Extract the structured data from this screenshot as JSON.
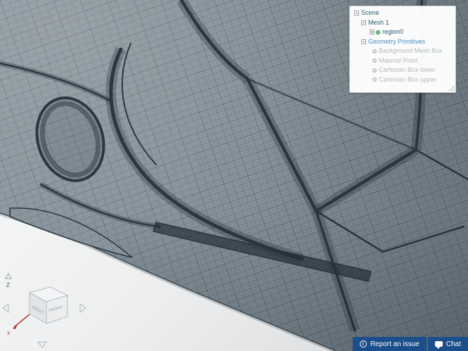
{
  "viewer": {
    "description": "3d-surface-mesh-viewport"
  },
  "scene_tree": {
    "items": [
      {
        "label": "Scene"
      },
      {
        "label": "Mesh 1"
      },
      {
        "label": "region0"
      },
      {
        "label": "Geometry Primitives"
      },
      {
        "label": "Background Mesh Box"
      },
      {
        "label": "Material Point"
      },
      {
        "label": "Cartesian Box lower"
      },
      {
        "label": "Cartesian Box upper"
      }
    ]
  },
  "nav_cube": {
    "axis_z": "Z",
    "axis_x": "X",
    "face_left": "RIGHT",
    "face_right": "FRONT"
  },
  "footer": {
    "report_label": "Report an issue",
    "chat_label": "Chat"
  },
  "colors": {
    "accent_blue": "#1b4e8a",
    "mesh_surface": "#8a959d",
    "mesh_lines": "#2b3840",
    "tree_primary": "#2e5d6e",
    "tree_section": "#4a8fc0",
    "tree_muted": "#b3bac0",
    "status_green": "#3fae49"
  }
}
